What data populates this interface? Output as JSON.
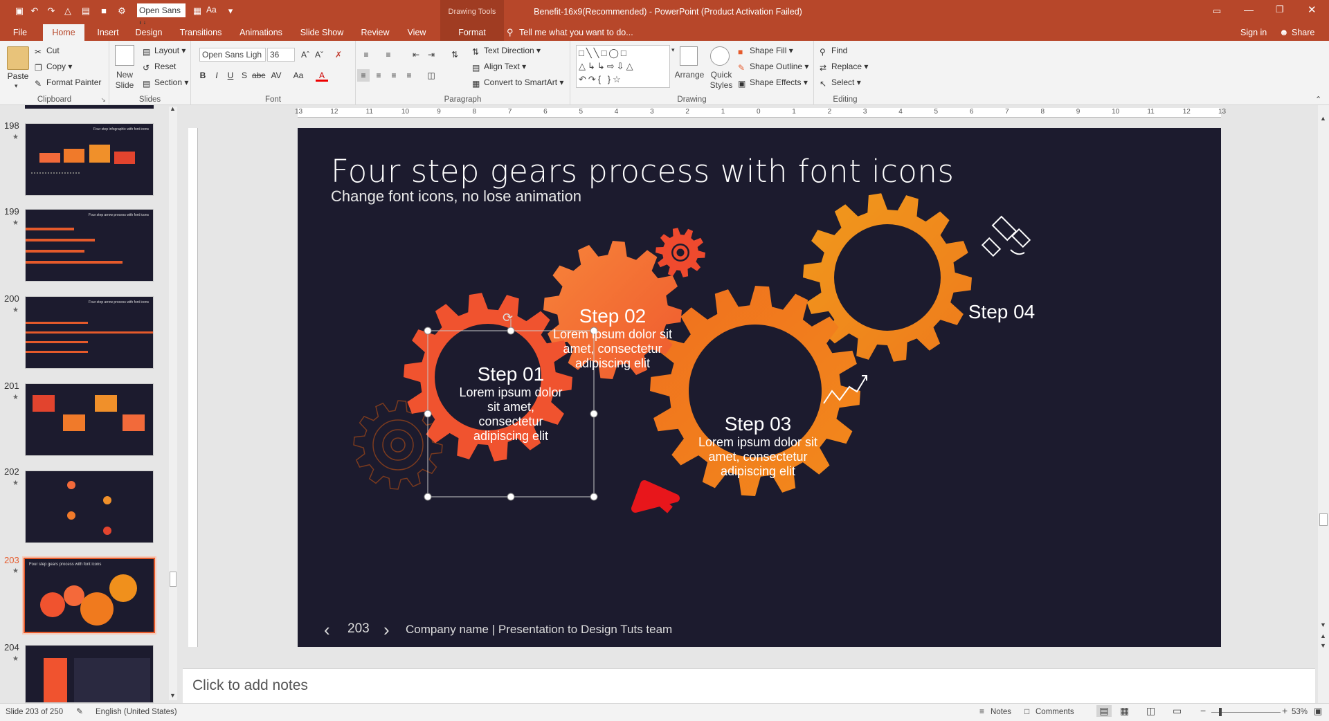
{
  "window": {
    "title": "Benefit-16x9(Recommended) - PowerPoint (Product Activation Failed)",
    "context_tab_group": "Drawing Tools"
  },
  "quick_access": {
    "font_name": "Open Sans Li",
    "font_size_label": "Aa"
  },
  "tabs": [
    {
      "label": "File"
    },
    {
      "label": "Home"
    },
    {
      "label": "Insert"
    },
    {
      "label": "Design"
    },
    {
      "label": "Transitions"
    },
    {
      "label": "Animations"
    },
    {
      "label": "Slide Show"
    },
    {
      "label": "Review"
    },
    {
      "label": "View"
    },
    {
      "label": "Format"
    }
  ],
  "tell_me": "Tell me what you want to do...",
  "signin": "Sign in",
  "share": "Share",
  "ribbon": {
    "clipboard": {
      "label": "Clipboard",
      "paste": "Paste",
      "cut": "Cut",
      "copy": "Copy",
      "format_painter": "Format Painter"
    },
    "slides": {
      "label": "Slides",
      "new_slide": "New",
      "new_slide2": "Slide",
      "layout": "Layout",
      "reset": "Reset",
      "section": "Section"
    },
    "font": {
      "label": "Font",
      "name": "Open Sans Ligh",
      "size": "36"
    },
    "paragraph": {
      "label": "Paragraph",
      "text_direction": "Text Direction",
      "align_text": "Align Text",
      "smartart": "Convert to SmartArt"
    },
    "drawing": {
      "label": "Drawing",
      "arrange": "Arrange",
      "quick": "Quick",
      "styles": "Styles",
      "shape_fill": "Shape Fill",
      "shape_outline": "Shape Outline",
      "shape_effects": "Shape Effects"
    },
    "editing": {
      "label": "Editing",
      "find": "Find",
      "replace": "Replace",
      "select": "Select"
    }
  },
  "ruler_numbers": [
    "13",
    "12",
    "11",
    "10",
    "9",
    "8",
    "7",
    "6",
    "5",
    "4",
    "3",
    "2",
    "1",
    "0",
    "1",
    "2",
    "3",
    "4",
    "5",
    "6",
    "7",
    "8",
    "9",
    "10",
    "11",
    "12",
    "13"
  ],
  "thumbnails": [
    {
      "num": "198",
      "title": "Four step infographic with font icons"
    },
    {
      "num": "199",
      "title": "Four step arrow process with font icons"
    },
    {
      "num": "200",
      "title": "Four step arrow process with font icons"
    },
    {
      "num": "201",
      "title": ""
    },
    {
      "num": "202",
      "title": ""
    },
    {
      "num": "203",
      "title": "Four step gears process with font icons"
    },
    {
      "num": "204",
      "title": ""
    }
  ],
  "slide": {
    "title": "Four step gears process with font icons",
    "subtitle": "Change font icons, no lose animation",
    "step1": {
      "title": "Step 01",
      "l1": "Lorem ipsum dolor",
      "l2": "sit amet,",
      "l3": "consectetur",
      "l4": "adipiscing elit"
    },
    "step2": {
      "title": "Step 02",
      "l1": "Lorem ipsum dolor sit",
      "l2": "amet, consectetur",
      "l3": "adipiscing elit"
    },
    "step3": {
      "title": "Step 03",
      "l1": "Lorem ipsum dolor sit",
      "l2": "amet, consectetur",
      "l3": "adipiscing elit"
    },
    "step4": {
      "title": "Step 04"
    },
    "page_number": "203",
    "footer": "Company name | Presentation to Design Tuts team"
  },
  "notes_placeholder": "Click to add notes",
  "status": {
    "slide_info": "Slide 203 of 250",
    "language": "English (United States)",
    "notes": "Notes",
    "comments": "Comments",
    "zoom": "53%"
  },
  "colors": {
    "accent": "#b7472a",
    "slide_bg": "#1c1b2e",
    "gear_red": "#f0532f",
    "gear_orange": "#f07a1e",
    "gear_amber": "#f0901c"
  }
}
